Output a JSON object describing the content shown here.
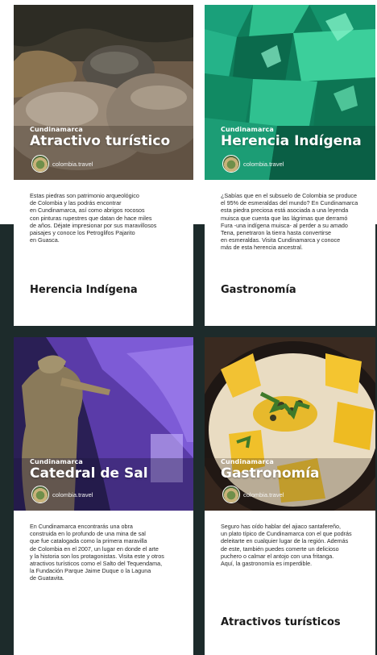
{
  "cards": [
    {
      "region": "Cundinamarca",
      "title": "Atractivo turístico",
      "brand": "colombia.travel",
      "body": "Estas piedras son patrimonio arqueológico\nde Colombia y las podrás encontrar\nen Cundinamarca, así como abrigos rocosos\ncon pinturas rupestres que datan de hace miles\nde años. Déjate impresionar por sus maravillosos\npaisajes y conoce los Petroglifos Pajarito\nen Guasca.",
      "next": "Herencia Indígena"
    },
    {
      "region": "Cundinamarca",
      "title": "Herencia Indígena",
      "brand": "colombia.travel",
      "body": "¿Sabías que en el subsuelo de Colombia se produce\nel 95% de esmeraldas del mundo? En Cundinamarca\nesta piedra preciosa está asociada a una leyenda\nmuisca que cuenta que las lágrimas que derramó\nFura -una indígena muisca- al perder a su amado\nTena, penetraron la tierra hasta convertirse\nen esmeraldas. Visita Cundinamarca y conoce\nmás de esta herencia ancestral.",
      "next": "Gastronomía"
    },
    {
      "region": "Cundinamarca",
      "title": "Catedral de Sal",
      "brand": "colombia.travel",
      "body": "En Cundinamarca encontrarás una obra\nconstruida en lo profundo de una mina de sal\nque fue catalogada como la primera maravilla\nde Colombia en el 2007, un lugar en donde el arte\ny la historia son los protagonistas. Visita este y otros\natractivos turísticos como el Salto del Tequendama,\nla Fundación Parque Jaime Duque o la Laguna\nde Guatavita.",
      "next": ""
    },
    {
      "region": "Cundinamarca",
      "title": "Gastronomía",
      "brand": "colombia.travel",
      "body": "Seguro has oído hablar del ajiaco santafereño,\nun plato típico de Cundinamarca con el que podrás\ndeleitarte en cualquier lugar de la región. Además\nde este, también puedes comerte un delicioso\npuchero o calmar el antojo con una fritanga.\nAquí, la gastronomía es imperdible.",
      "next": "Atractivos turísticos"
    }
  ],
  "colors": {
    "dark_background": "#1d2b2b",
    "overlay_text": "#ffffff",
    "body_text": "#2a2a2a"
  }
}
